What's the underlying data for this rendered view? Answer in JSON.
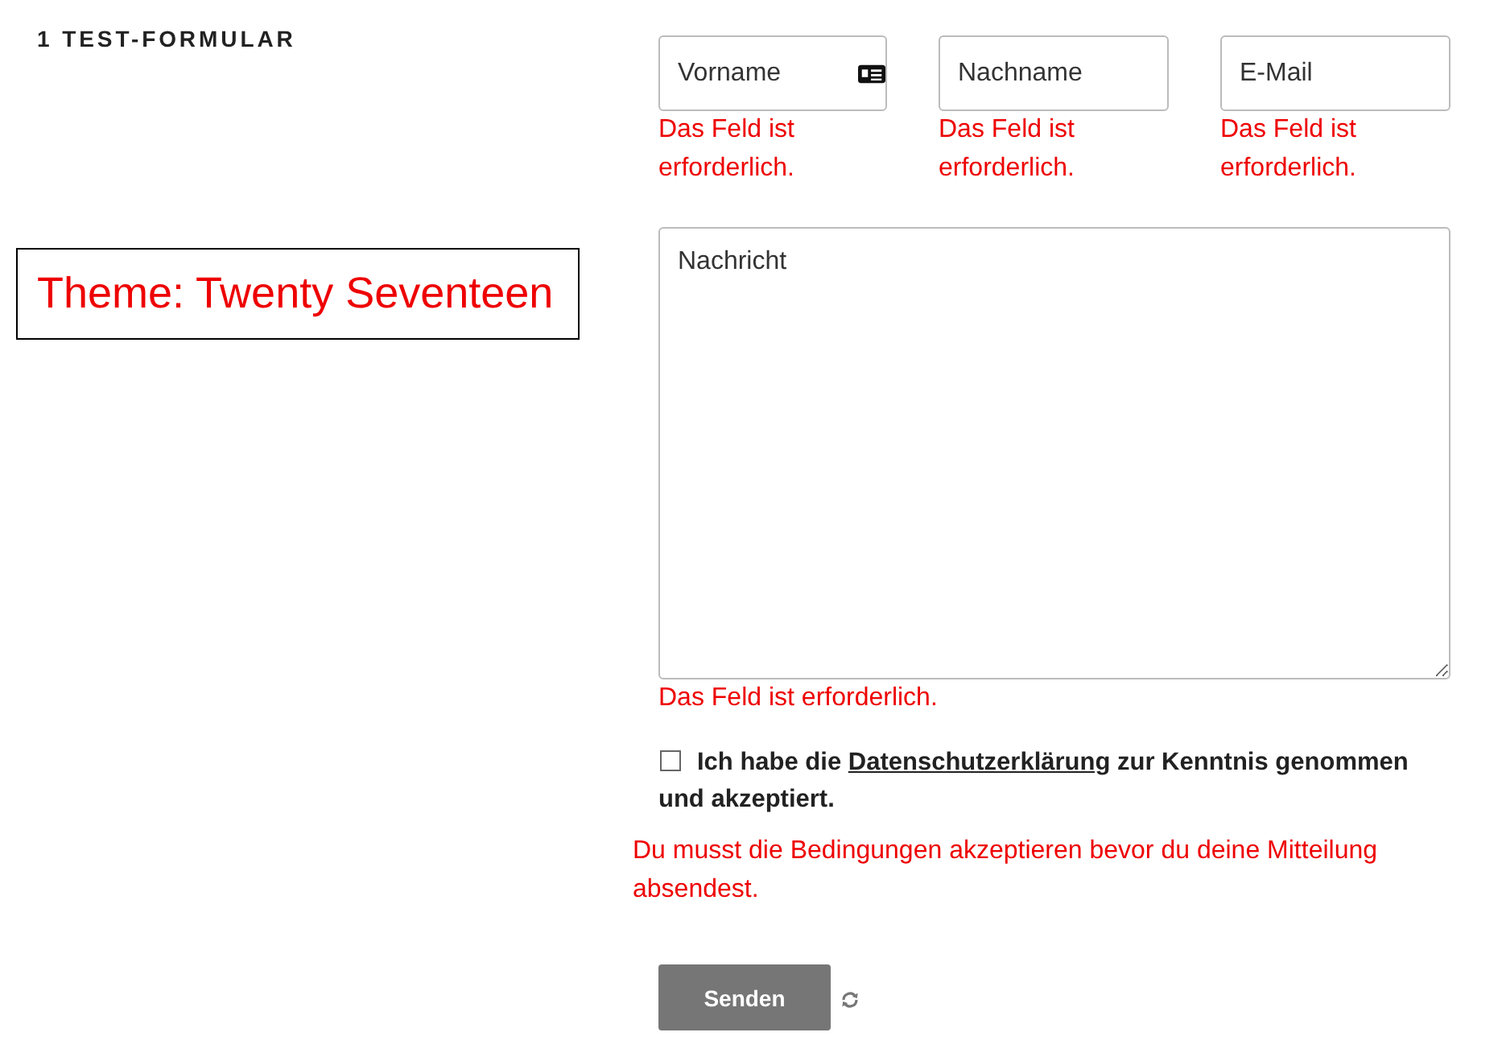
{
  "heading": "1 TEST-FORMULAR",
  "theme_note": "Theme: Twenty Seventeen",
  "fields": [
    {
      "placeholder": "Vorname",
      "autofill_icon": true,
      "error": "Das Feld ist erforderlich."
    },
    {
      "placeholder": "Nachname",
      "autofill_icon": false,
      "error": "Das Feld ist erforderlich."
    },
    {
      "placeholder": "E-Mail",
      "autofill_icon": false,
      "error": "Das Feld ist erforderlich."
    }
  ],
  "message": {
    "placeholder": "Nachricht",
    "error": "Das Feld ist erforderlich."
  },
  "consent": {
    "checked": false,
    "text_before": "Ich habe die",
    "link": "Datenschutzerklärung",
    "text_after": "zur Kenntnis genommen und akzeptiert."
  },
  "consent_error": "Du musst die Bedingungen akzeptieren bevor du deine Mitteilung absendest.",
  "submit": {
    "label": "Senden",
    "disabled": true
  }
}
